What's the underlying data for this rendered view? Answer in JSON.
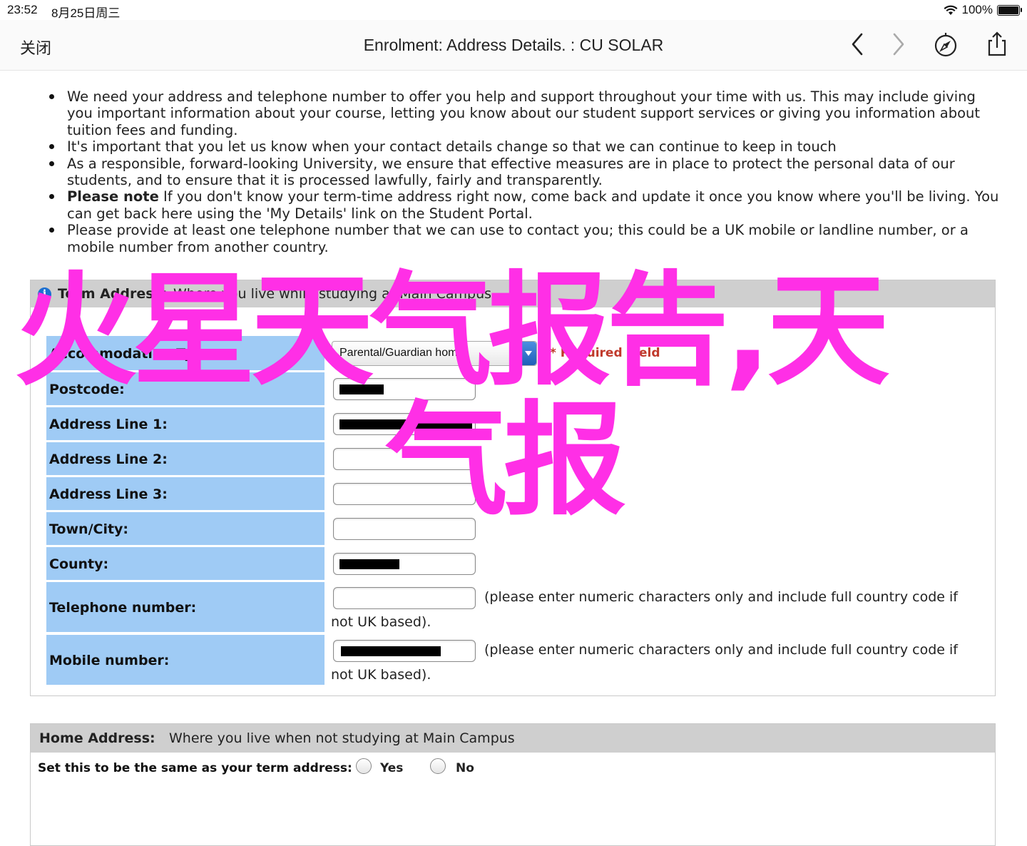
{
  "status": {
    "time": "23:52",
    "date": "8月25日周三",
    "battery": "100%"
  },
  "nav": {
    "close_label": "关闭",
    "title": "Enrolment: Address Details. : CU SOLAR"
  },
  "bullets": [
    {
      "bold": "",
      "text": "We need your address and telephone number to offer you help and support throughout your time with us. This may include giving you important information about your course, letting you know about our student support services or giving you information about tuition fees and funding."
    },
    {
      "bold": "",
      "text": "It's important that you let us know when your contact details change so that we can continue to keep in touch"
    },
    {
      "bold": "",
      "text": "As a responsible, forward-looking University, we ensure that effective measures are in place to protect the personal data of our students, and to ensure that it is processed lawfully, fairly and transparently."
    },
    {
      "bold": "Please note",
      "text": " If you don't know your term-time address right now, come back and update it once you know where you'll be living. You can get back here using the 'My Details' link on the Student Portal."
    },
    {
      "bold": "",
      "text": "Please provide at least one telephone number that we can use to contact you; this could be a UK mobile or landline number, or a mobile number from another country."
    }
  ],
  "term": {
    "title": "Term Address:",
    "subtitle": "Where you live while studying at Main Campus",
    "accommodation_label": "Accommodation Type:",
    "accommodation_value": "Parental/Guardian home",
    "required_note": "* Required Field",
    "postcode_label": "Postcode:",
    "address1_label": "Address Line 1:",
    "address2_label": "Address Line 2:",
    "address3_label": "Address Line 3:",
    "town_label": "Town/City:",
    "county_label": "County:",
    "telephone_label": "Telephone number:",
    "mobile_label": "Mobile number:",
    "phone_note_1": "(please enter numeric characters only and include full country code if",
    "phone_note_2": "not UK based)."
  },
  "home": {
    "title": "Home Address:",
    "subtitle": "Where you live when not studying at Main Campus",
    "same_label": "Set this to be the same as your term address:",
    "yes_label": "Yes",
    "no_label": "No"
  },
  "overlay": {
    "line1": "火星天气报告,天",
    "line2": "气报"
  },
  "colors": {
    "label_bg": "#9fcbf5",
    "header_bg": "#cfcfcf",
    "overlay": "#ff2fe6",
    "info": "#1c6fd1"
  }
}
